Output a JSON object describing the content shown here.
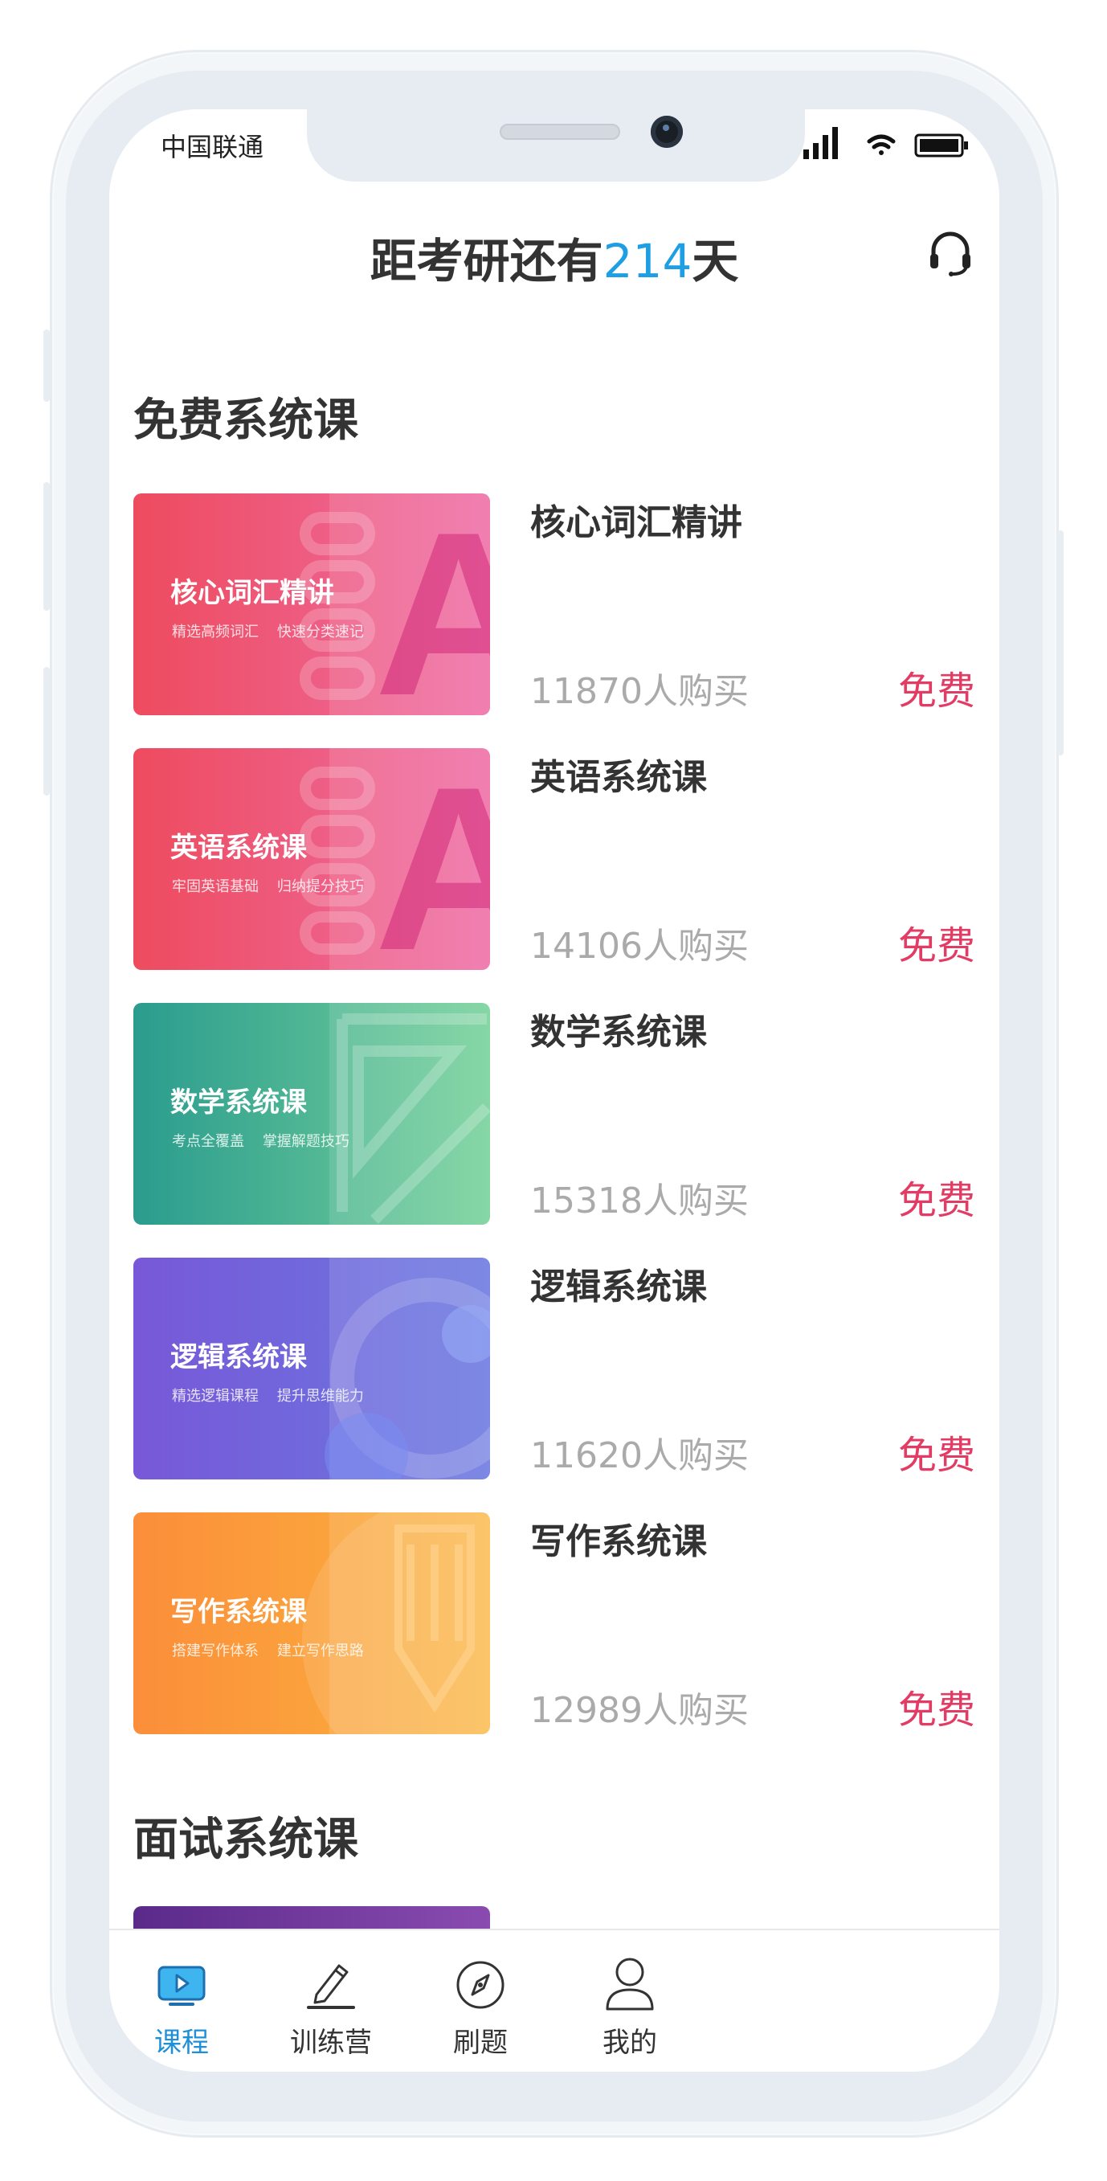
{
  "status_bar": {
    "carrier": "中国联通"
  },
  "header": {
    "prefix": "距考研还有",
    "days": "214",
    "suffix": "天"
  },
  "sections": [
    {
      "title": "免费系统课"
    },
    {
      "title": "面试系统课"
    }
  ],
  "courses": [
    {
      "thumb_title": "核心词汇精讲",
      "thumb_sub": "精选高频词汇    快速分类速记",
      "name": "核心词汇精讲",
      "buyers": "11870人购买",
      "price": "免费",
      "colors": [
        "#ee4b5e",
        "#ee6ea6"
      ]
    },
    {
      "thumb_title": "英语系统课",
      "thumb_sub": "牢固英语基础    归纳提分技巧",
      "name": "英语系统课",
      "buyers": "14106人购买",
      "price": "免费",
      "colors": [
        "#ee4b5e",
        "#ee6ea6"
      ]
    },
    {
      "thumb_title": "数学系统课",
      "thumb_sub": "考点全覆盖    掌握解题技巧",
      "name": "数学系统课",
      "buyers": "15318人购买",
      "price": "免费",
      "colors": [
        "#2a9c8e",
        "#76d19a"
      ]
    },
    {
      "thumb_title": "逻辑系统课",
      "thumb_sub": "精选逻辑课程    提升思维能力",
      "name": "逻辑系统课",
      "buyers": "11620人购买",
      "price": "免费",
      "colors": [
        "#7858d8",
        "#6a78e0"
      ]
    },
    {
      "thumb_title": "写作系统课",
      "thumb_sub": "搭建写作体系    建立写作思路",
      "name": "写作系统课",
      "buyers": "12989人购买",
      "price": "免费",
      "colors": [
        "#fb8e3a",
        "#fbb43e"
      ]
    }
  ],
  "tabs": [
    {
      "label": "课程",
      "icon": "play-tv-icon",
      "active": true
    },
    {
      "label": "训练营",
      "icon": "pencil-icon",
      "active": false
    },
    {
      "label": "刷题",
      "icon": "compass-icon",
      "active": false
    },
    {
      "label": "我的",
      "icon": "user-icon",
      "active": false
    }
  ],
  "colors": {
    "accent": "#1e9ee3",
    "price": "#e33c64"
  }
}
